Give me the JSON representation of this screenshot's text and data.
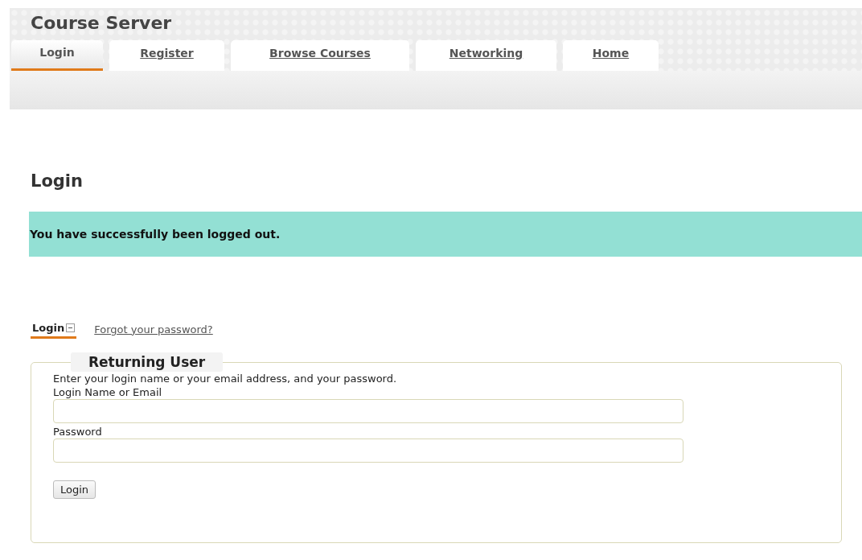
{
  "site": {
    "title": "Course Server"
  },
  "nav_tabs": [
    {
      "label": "Login",
      "selected": true
    },
    {
      "label": "Register",
      "selected": false
    },
    {
      "label": "Browse Courses",
      "selected": false
    },
    {
      "label": "Networking",
      "selected": false
    },
    {
      "label": "Home",
      "selected": false
    }
  ],
  "page_heading": "Login",
  "notice": "You have successfully been logged out.",
  "sub_tabs": [
    {
      "label": "Login",
      "selected": true,
      "kind": "tab"
    },
    {
      "label": "Forgot your password?",
      "selected": false,
      "kind": "link"
    }
  ],
  "form": {
    "legend": "Returning User",
    "instructions": "Enter your login name or your email address, and your password.",
    "fields": [
      {
        "label": "Login Name or Email"
      },
      {
        "label": "Password"
      }
    ],
    "submit": "Login"
  }
}
